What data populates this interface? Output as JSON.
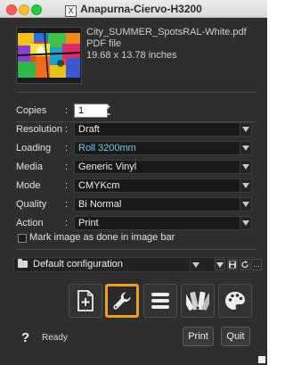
{
  "window": {
    "title": "Anapurna-Ciervo-H3200",
    "title_icon": "X"
  },
  "file": {
    "name": "City_SUMMER_SpotsRAL-White.pdf",
    "type": "PDF file",
    "size": "19.68 x 13.78 inches"
  },
  "settings": {
    "copies_label": "Copies",
    "copies_value": "1",
    "colon": ":",
    "resolution_label": "Resolution",
    "resolution_value": "Draft",
    "loading_label": "Loading",
    "loading_value": "Roll 3200mm",
    "media_label": "Media",
    "media_value": "Generic Vinyl",
    "mode_label": "Mode",
    "mode_value": "CMYKcm",
    "quality_label": "Quality",
    "quality_value": "Bi Normal",
    "action_label": "Action",
    "action_value": "Print"
  },
  "mark_image_label": "Mark image as done in image bar",
  "configuration": {
    "label": "Default configuration",
    "more": "..."
  },
  "toolbar_icons": [
    "add-page-icon",
    "wrench-icon",
    "list-icon",
    "swatches-icon",
    "palette-icon"
  ],
  "accent_color": "#f0a020",
  "status": {
    "help": "?",
    "text": "Ready"
  },
  "buttons": {
    "print": "Print",
    "quit": "Quit"
  }
}
